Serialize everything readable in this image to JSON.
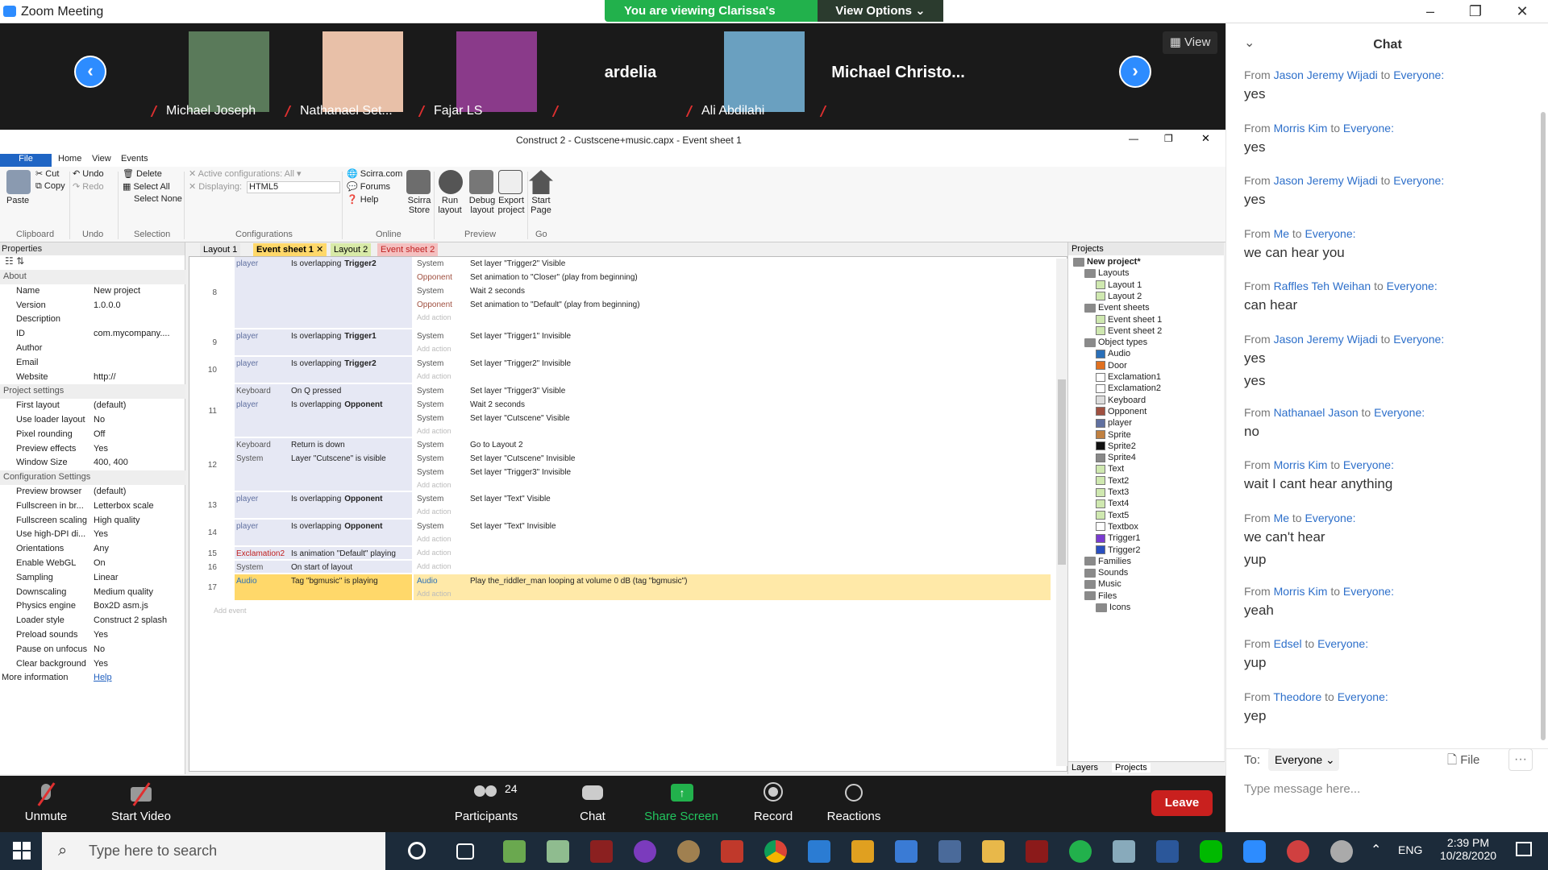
{
  "zoom": {
    "title": "Zoom Meeting",
    "share_msg": "You are viewing Clarissa's screen",
    "view_options": "View Options",
    "gallery_view": "View"
  },
  "participants": [
    {
      "name": "Michael Joseph",
      "thumb": "#5a7a5a"
    },
    {
      "name": "Nathanael Set...",
      "thumb": "#e8c0a8"
    },
    {
      "name": "Fajar LS",
      "thumb": "#8a3a8a"
    },
    {
      "name": "ardelia",
      "thumb": ""
    },
    {
      "name": "Ali Abdilahi",
      "thumb": "#6aa0c0"
    },
    {
      "name": "Michael Christo...",
      "thumb": ""
    }
  ],
  "construct": {
    "title": "Construct 2 - Custscene+music.capx - Event sheet 1",
    "menu": {
      "file": "File",
      "home": "Home",
      "view": "View",
      "events": "Events"
    },
    "ribbon": {
      "paste": "Paste",
      "cut": "Cut",
      "copy": "Copy",
      "undo": "Undo",
      "redo": "Redo",
      "delete": "Delete",
      "select_all": "Select All",
      "select_none": "Select None",
      "active_config": "Active configurations: All",
      "displaying": "Displaying:",
      "html5": "HTML5",
      "scirra": "Scirra.com",
      "forums": "Forums",
      "help": "Help",
      "scirra_store": "Scirra Store",
      "run_layout": "Run layout",
      "debug_layout": "Debug layout",
      "export_project": "Export project",
      "start_page": "Start Page",
      "groups": {
        "clipboard": "Clipboard",
        "undo": "Undo",
        "selection": "Selection",
        "configurations": "Configurations",
        "online": "Online",
        "preview": "Preview",
        "go": "Go"
      }
    },
    "properties": {
      "header": "Properties",
      "rows": [
        {
          "k": "About",
          "v": "",
          "sec": true
        },
        {
          "k": "Name",
          "v": "New project"
        },
        {
          "k": "Version",
          "v": "1.0.0.0"
        },
        {
          "k": "Description",
          "v": ""
        },
        {
          "k": "ID",
          "v": "com.mycompany...."
        },
        {
          "k": "Author",
          "v": ""
        },
        {
          "k": "Email",
          "v": ""
        },
        {
          "k": "Website",
          "v": "http://"
        },
        {
          "k": "Project settings",
          "v": "",
          "sec": true
        },
        {
          "k": "First layout",
          "v": "(default)"
        },
        {
          "k": "Use loader layout",
          "v": "No"
        },
        {
          "k": "Pixel rounding",
          "v": "Off"
        },
        {
          "k": "Preview effects",
          "v": "Yes"
        },
        {
          "k": "Window Size",
          "v": "400, 400"
        },
        {
          "k": "Configuration Settings",
          "v": "",
          "sec": true
        },
        {
          "k": "Preview browser",
          "v": "(default)"
        },
        {
          "k": "Fullscreen in br...",
          "v": "Letterbox scale"
        },
        {
          "k": "Fullscreen scaling",
          "v": "High quality"
        },
        {
          "k": "Use high-DPI di...",
          "v": "Yes"
        },
        {
          "k": "Orientations",
          "v": "Any"
        },
        {
          "k": "Enable WebGL",
          "v": "On"
        },
        {
          "k": "Sampling",
          "v": "Linear"
        },
        {
          "k": "Downscaling",
          "v": "Medium quality"
        },
        {
          "k": "Physics engine",
          "v": "Box2D asm.js"
        },
        {
          "k": "Loader style",
          "v": "Construct 2 splash"
        },
        {
          "k": "Preload sounds",
          "v": "Yes"
        },
        {
          "k": "Pause on unfocus",
          "v": "No"
        },
        {
          "k": "Clear background",
          "v": "Yes"
        }
      ],
      "more_info": "More information",
      "help_link": "Help"
    },
    "tabs": [
      "Layout 1",
      "Event sheet 1",
      "Layout 2",
      "Event sheet 2"
    ],
    "events": [
      {
        "n": "8",
        "h": 90,
        "conds": [
          {
            "obj": "player",
            "txt": "Is overlapping",
            "tgt": "Trigger2"
          }
        ],
        "acts": [
          {
            "obj": "System",
            "txt": "Set layer \"Trigger2\" Visible"
          },
          {
            "obj": "Opponent",
            "txt": "Set animation to \"Closer\" (play from beginning)"
          },
          {
            "obj": "System",
            "txt": "Wait 2 seconds"
          },
          {
            "obj": "Opponent",
            "txt": "Set animation to \"Default\" (play from beginning)"
          }
        ]
      },
      {
        "n": "9",
        "h": 34,
        "conds": [
          {
            "obj": "player",
            "txt": "Is overlapping",
            "tgt": "Trigger1"
          }
        ],
        "acts": [
          {
            "obj": "System",
            "txt": "Set layer \"Trigger1\" Invisible"
          }
        ]
      },
      {
        "n": "10",
        "h": 34,
        "conds": [
          {
            "obj": "player",
            "txt": "Is overlapping",
            "tgt": "Trigger2"
          }
        ],
        "acts": [
          {
            "obj": "System",
            "txt": "Set layer \"Trigger2\" Invisible"
          }
        ]
      },
      {
        "n": "11",
        "h": 67,
        "conds": [
          {
            "obj": "Keyboard",
            "txt": "On Q pressed",
            "tgt": ""
          },
          {
            "obj": "player",
            "txt": "Is overlapping",
            "tgt": "Opponent"
          }
        ],
        "acts": [
          {
            "obj": "System",
            "txt": "Set layer \"Trigger3\" Visible"
          },
          {
            "obj": "System",
            "txt": "Wait 2 seconds"
          },
          {
            "obj": "System",
            "txt": "Set layer \"Cutscene\" Visible"
          }
        ]
      },
      {
        "n": "12",
        "h": 67,
        "conds": [
          {
            "obj": "Keyboard",
            "txt": "Return is down",
            "tgt": ""
          },
          {
            "obj": "System",
            "txt": "Layer \"Cutscene\" is visible",
            "tgt": ""
          }
        ],
        "acts": [
          {
            "obj": "System",
            "txt": "Go to Layout 2"
          },
          {
            "obj": "System",
            "txt": "Set layer \"Cutscene\" Invisible"
          },
          {
            "obj": "System",
            "txt": "Set layer \"Trigger3\" Invisible"
          }
        ]
      },
      {
        "n": "13",
        "h": 34,
        "conds": [
          {
            "obj": "player",
            "txt": "Is overlapping",
            "tgt": "Opponent"
          }
        ],
        "acts": [
          {
            "obj": "System",
            "txt": "Set layer \"Text\" Visible"
          }
        ]
      },
      {
        "n": "14",
        "h": 34,
        "conds": [
          {
            "obj": "player",
            "txt": "Is overlapping",
            "tgt": "Opponent"
          }
        ],
        "acts": [
          {
            "obj": "System",
            "txt": "Set layer \"Text\" Invisible"
          }
        ]
      },
      {
        "n": "15",
        "h": 17,
        "conds": [
          {
            "obj": "Exclamation2",
            "txt": "Is animation \"Default\" playing",
            "tgt": ""
          }
        ],
        "acts": []
      },
      {
        "n": "16",
        "h": 17,
        "conds": [
          {
            "obj": "System",
            "txt": "On start of layout",
            "tgt": ""
          }
        ],
        "acts": []
      },
      {
        "n": "17",
        "h": 34,
        "conds": [
          {
            "obj": "Audio",
            "txt": "Tag \"bgmusic\" is playing",
            "tgt": ""
          }
        ],
        "acts": [
          {
            "obj": "Audio",
            "txt": "Play the_riddler_man looping at volume 0 dB (tag \"bgmusic\")"
          }
        ]
      }
    ],
    "add_action": "Add action",
    "add_event": "Add event",
    "projects": {
      "header": "Projects",
      "tree": [
        {
          "d": 0,
          "t": "New project*",
          "f": true,
          "b": true
        },
        {
          "d": 1,
          "t": "Layouts",
          "f": true
        },
        {
          "d": 2,
          "t": "Layout 1"
        },
        {
          "d": 2,
          "t": "Layout 2"
        },
        {
          "d": 1,
          "t": "Event sheets",
          "f": true
        },
        {
          "d": 2,
          "t": "Event sheet 1"
        },
        {
          "d": 2,
          "t": "Event sheet 2"
        },
        {
          "d": 1,
          "t": "Object types",
          "f": true
        },
        {
          "d": 2,
          "t": "Audio"
        },
        {
          "d": 2,
          "t": "Door"
        },
        {
          "d": 2,
          "t": "Exclamation1"
        },
        {
          "d": 2,
          "t": "Exclamation2"
        },
        {
          "d": 2,
          "t": "Keyboard"
        },
        {
          "d": 2,
          "t": "Opponent"
        },
        {
          "d": 2,
          "t": "player"
        },
        {
          "d": 2,
          "t": "Sprite"
        },
        {
          "d": 2,
          "t": "Sprite2"
        },
        {
          "d": 2,
          "t": "Sprite4"
        },
        {
          "d": 2,
          "t": "Text"
        },
        {
          "d": 2,
          "t": "Text2"
        },
        {
          "d": 2,
          "t": "Text3"
        },
        {
          "d": 2,
          "t": "Text4"
        },
        {
          "d": 2,
          "t": "Text5"
        },
        {
          "d": 2,
          "t": "Textbox"
        },
        {
          "d": 2,
          "t": "Trigger1"
        },
        {
          "d": 2,
          "t": "Trigger2"
        },
        {
          "d": 1,
          "t": "Families",
          "f": true
        },
        {
          "d": 1,
          "t": "Sounds",
          "f": true
        },
        {
          "d": 1,
          "t": "Music",
          "f": true
        },
        {
          "d": 1,
          "t": "Files",
          "f": true
        },
        {
          "d": 2,
          "t": "Icons",
          "f": true
        }
      ],
      "bottom_tabs": [
        "Layers",
        "Projects"
      ]
    }
  },
  "controls": {
    "unmute": "Unmute",
    "start_video": "Start Video",
    "participants": "Participants",
    "participants_count": "24",
    "chat": "Chat",
    "share_screen": "Share Screen",
    "record": "Record",
    "reactions": "Reactions",
    "leave": "Leave"
  },
  "chat": {
    "title": "Chat",
    "messages": [
      {
        "from": "Jason Jeremy Wijadi",
        "to": "Everyone:",
        "lines": [
          "yes"
        ]
      },
      {
        "from": "Morris Kim",
        "to": "Everyone:",
        "lines": [
          "yes"
        ]
      },
      {
        "from": "Jason Jeremy Wijadi",
        "to": "Everyone:",
        "lines": [
          "yes"
        ]
      },
      {
        "from": "Me",
        "to": "Everyone:",
        "lines": [
          "we can hear you"
        ]
      },
      {
        "from": "Raffles Teh Weihan",
        "to": "Everyone:",
        "lines": [
          "can hear"
        ]
      },
      {
        "from": "Jason Jeremy Wijadi",
        "to": "Everyone:",
        "lines": [
          "yes",
          "yes"
        ]
      },
      {
        "from": "Nathanael Jason",
        "to": "Everyone:",
        "lines": [
          "no"
        ]
      },
      {
        "from": "Morris Kim",
        "to": "Everyone:",
        "lines": [
          "wait I cant hear anything"
        ]
      },
      {
        "from": "Me",
        "to": "Everyone:",
        "lines": [
          "we can't hear",
          "yup"
        ]
      },
      {
        "from": "Morris Kim",
        "to": "Everyone:",
        "lines": [
          "yeah"
        ]
      },
      {
        "from": "Edsel",
        "to": "Everyone:",
        "lines": [
          "yup"
        ]
      },
      {
        "from": "Theodore",
        "to": "Everyone:",
        "lines": [
          "yep"
        ]
      }
    ],
    "to_label": "To:",
    "to_value": "Everyone",
    "file": "File",
    "placeholder": "Type message here..."
  },
  "taskbar": {
    "search_placeholder": "Type here to search",
    "lang": "ENG",
    "time": "2:39 PM",
    "date": "10/28/2020"
  }
}
